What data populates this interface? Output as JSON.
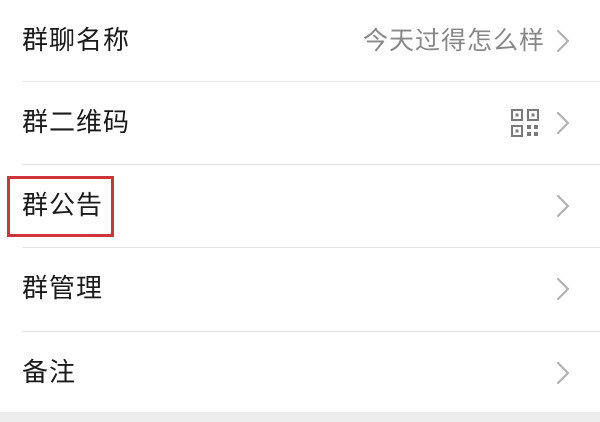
{
  "rows": [
    {
      "label": "群聊名称",
      "value": "今天过得怎么样",
      "icon": "chevron-right-icon"
    },
    {
      "label": "群二维码",
      "icon": "qr-code-icon"
    },
    {
      "label": "群公告",
      "icon": "chevron-right-icon",
      "highlighted": true
    },
    {
      "label": "群管理",
      "icon": "chevron-right-icon"
    },
    {
      "label": "备注",
      "icon": "chevron-right-icon"
    }
  ],
  "colors": {
    "background": "#ededed",
    "row_background": "#ffffff",
    "label": "#1a1a1a",
    "value": "#888888",
    "chevron": "#b2b2b2",
    "divider": "#e6e6e6",
    "highlight": "#d0343b"
  }
}
